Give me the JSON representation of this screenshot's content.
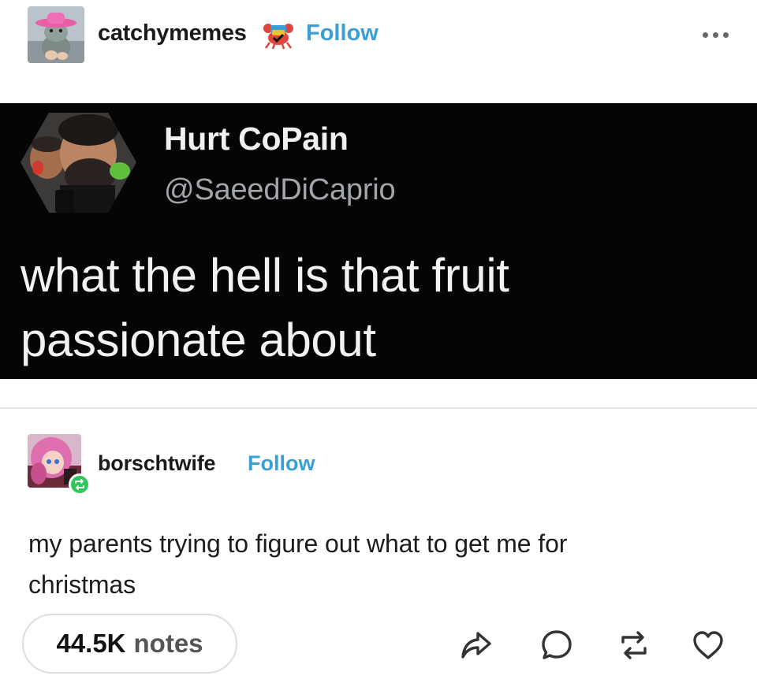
{
  "post": {
    "author": "catchymemes",
    "follow_label": "Follow",
    "badge_icon": "crab-icon",
    "menu_icon": "more-icon"
  },
  "tweet": {
    "display_name": "Hurt CoPain",
    "handle": "@SaeedDiCaprio",
    "text_line1": "what the hell is that fruit",
    "text_line2": "passionate about"
  },
  "reblog": {
    "author": "borschtwife",
    "follow_label": "Follow",
    "text_line1": "my parents trying to figure out what to get me for",
    "text_line2": "christmas"
  },
  "footer": {
    "notes_count": "44.5K",
    "notes_label": "notes",
    "actions": [
      "share-icon",
      "reply-icon",
      "reblog-icon",
      "like-icon"
    ]
  },
  "colors": {
    "accent": "#3a9fd4",
    "reblog_badge": "#2fc65b",
    "tweet_background": "#050505"
  }
}
